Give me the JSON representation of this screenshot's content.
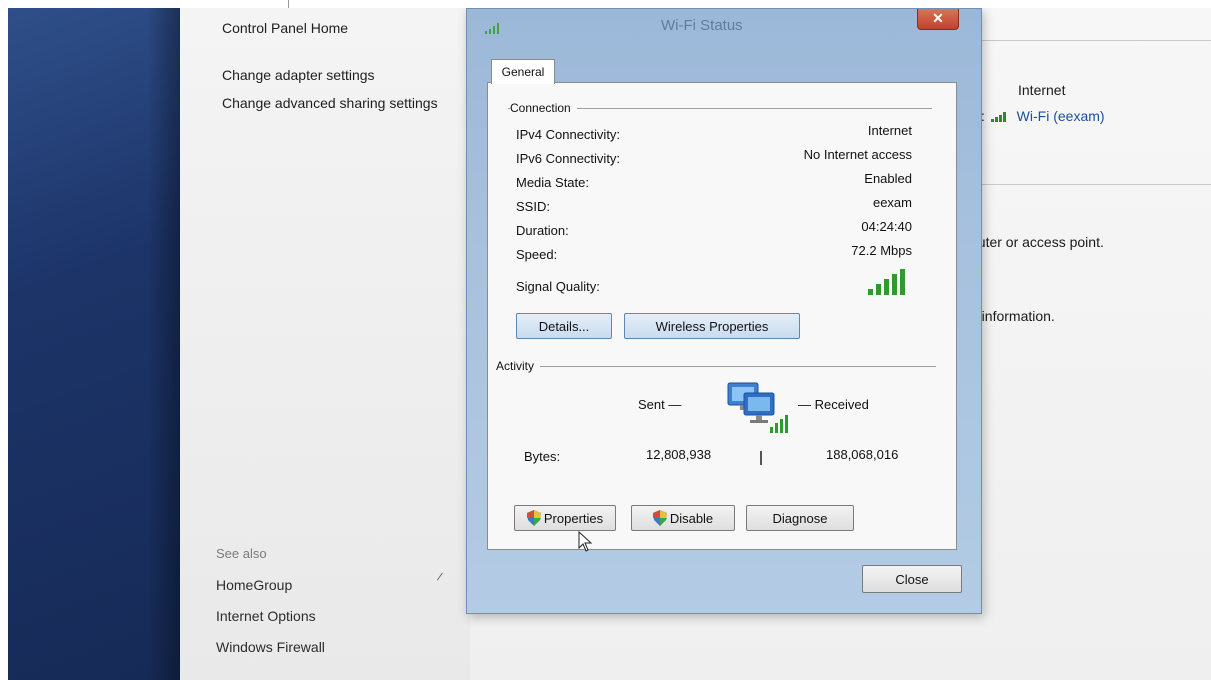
{
  "control_panel": {
    "home": "Control Panel Home",
    "links": [
      "Change adapter settings",
      "Change advanced sharing settings"
    ],
    "see_also": "See also",
    "see_also_links": [
      "HomeGroup",
      "Internet Options",
      "Windows Firewall"
    ]
  },
  "right_pane": {
    "access_type": "Internet",
    "connections_prefix": "s:",
    "connection_name": "Wi-Fi (eexam)",
    "router_text": "outer or access point.",
    "info_text": "g information."
  },
  "dialog": {
    "title": "Wi-Fi Status",
    "tab": "General",
    "connection_group": "Connection",
    "rows": [
      {
        "label": "IPv4 Connectivity:",
        "value": "Internet"
      },
      {
        "label": "IPv6 Connectivity:",
        "value": "No Internet access"
      },
      {
        "label": "Media State:",
        "value": "Enabled"
      },
      {
        "label": "SSID:",
        "value": "eexam"
      },
      {
        "label": "Duration:",
        "value": "04:24:40"
      },
      {
        "label": "Speed:",
        "value": "72.2 Mbps"
      }
    ],
    "signal_quality_label": "Signal Quality:",
    "signal_bars": 5,
    "details_button": "Details...",
    "wireless_button": "Wireless Properties",
    "activity_group": "Activity",
    "sent_label": "Sent",
    "received_label": "Received",
    "bytes_label": "Bytes:",
    "bytes_sent": "12,808,938",
    "bytes_received": "188,068,016",
    "properties_button": "Properties",
    "disable_button": "Disable",
    "diagnose_button": "Diagnose",
    "close_button": "Close",
    "close_x": "✕"
  },
  "colors": {
    "dialog_frame": "#a7c1de",
    "close_red": "#c1422b",
    "signal_green": "#2f9a2f"
  }
}
